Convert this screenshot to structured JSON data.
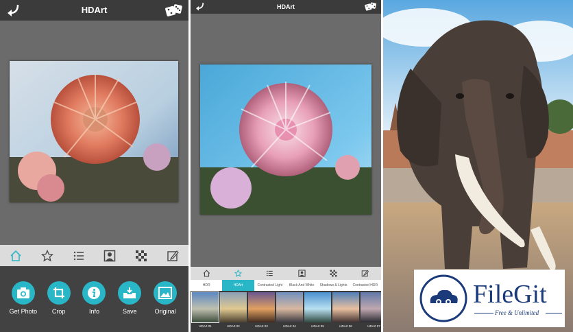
{
  "app": {
    "title": "HDArt"
  },
  "bottom_actions": [
    {
      "label": "Get Photo",
      "icon": "camera-icon"
    },
    {
      "label": "Crop",
      "icon": "crop-icon"
    },
    {
      "label": "Info",
      "icon": "info-icon"
    },
    {
      "label": "Save",
      "icon": "save-icon"
    },
    {
      "label": "Original",
      "icon": "original-icon"
    }
  ],
  "toolbar_icons": [
    "home-icon",
    "star-icon",
    "list-icon",
    "portrait-icon",
    "checker-icon",
    "edit-icon"
  ],
  "filter_tabs": [
    {
      "label": "HDR",
      "active": false
    },
    {
      "label": "HDArt",
      "active": true
    },
    {
      "label": "Contrasted Light",
      "active": false
    },
    {
      "label": "Black And White",
      "active": false
    },
    {
      "label": "Shadows & Lights",
      "active": false
    },
    {
      "label": "Contrasted HDR",
      "active": false
    }
  ],
  "thumbnails": [
    "HDArt 01",
    "HDArt 02",
    "HDArt 03",
    "HDArt 04",
    "HDArt 05",
    "HDArt 06",
    "HDArt 07"
  ],
  "watermark": {
    "brand": "FileGit",
    "tagline": "Free & Unlimited"
  },
  "colors": {
    "accent": "#29b6c6",
    "titlebar": "#3b3b3b",
    "brand": "#1a3a7a"
  }
}
